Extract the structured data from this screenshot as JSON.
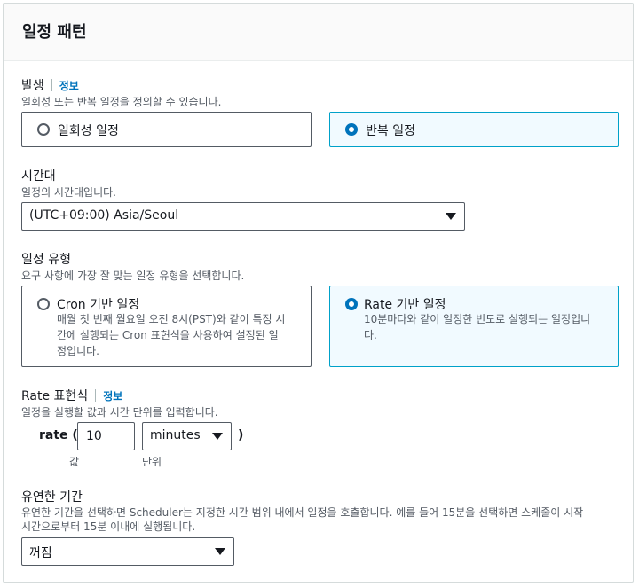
{
  "panel": {
    "title": "일정 패턴"
  },
  "occurrence": {
    "label": "발생",
    "info": "정보",
    "description": "일회성 또는 반복 일정을 정의할 수 있습니다.",
    "options": [
      {
        "label": "일회성 일정",
        "selected": false
      },
      {
        "label": "반복 일정",
        "selected": true
      }
    ]
  },
  "timezone": {
    "label": "시간대",
    "description": "일정의 시간대입니다.",
    "value": "(UTC+09:00) Asia/Seoul"
  },
  "schedule_type": {
    "label": "일정 유형",
    "description": "요구 사항에 가장 잘 맞는 일정 유형을 선택합니다.",
    "options": [
      {
        "label": "Cron 기반 일정",
        "description_lines": [
          "매월 첫 번째 월요일 오전 8시(PST)와 같이 특정 시",
          "간에 실행되는 Cron 표현식을 사용하여 설정된 일",
          "정입니다."
        ],
        "selected": false
      },
      {
        "label": "Rate 기반 일정",
        "description_lines": [
          "10분마다와 같이 일정한 빈도로 실행되는 일정입니",
          "다."
        ],
        "selected": true
      }
    ]
  },
  "rate_expression": {
    "label": "Rate 표현식",
    "info": "정보",
    "description": "일정을 실행할 값과 시간 단위를 입력합니다.",
    "prefix": "rate (",
    "suffix": ")",
    "value": "10",
    "value_caption": "값",
    "unit": "minutes",
    "unit_caption": "단위"
  },
  "flexible_window": {
    "label": "유연한 기간",
    "description_lines": [
      "유연한 기간을 선택하면 Scheduler는 지정한 시간 범위 내에서 일정을 호출합니다. 예를 들어 15분을 선택하면 스케줄이 시작",
      "시간으로부터 15분 이내에 실행됩니다."
    ],
    "value": "꺼짐"
  },
  "colors": {
    "accent": "#0073bb",
    "selected_border": "#00a1c9",
    "selected_bg": "#f1faff",
    "text": "#16191f",
    "muted": "#545b64"
  }
}
